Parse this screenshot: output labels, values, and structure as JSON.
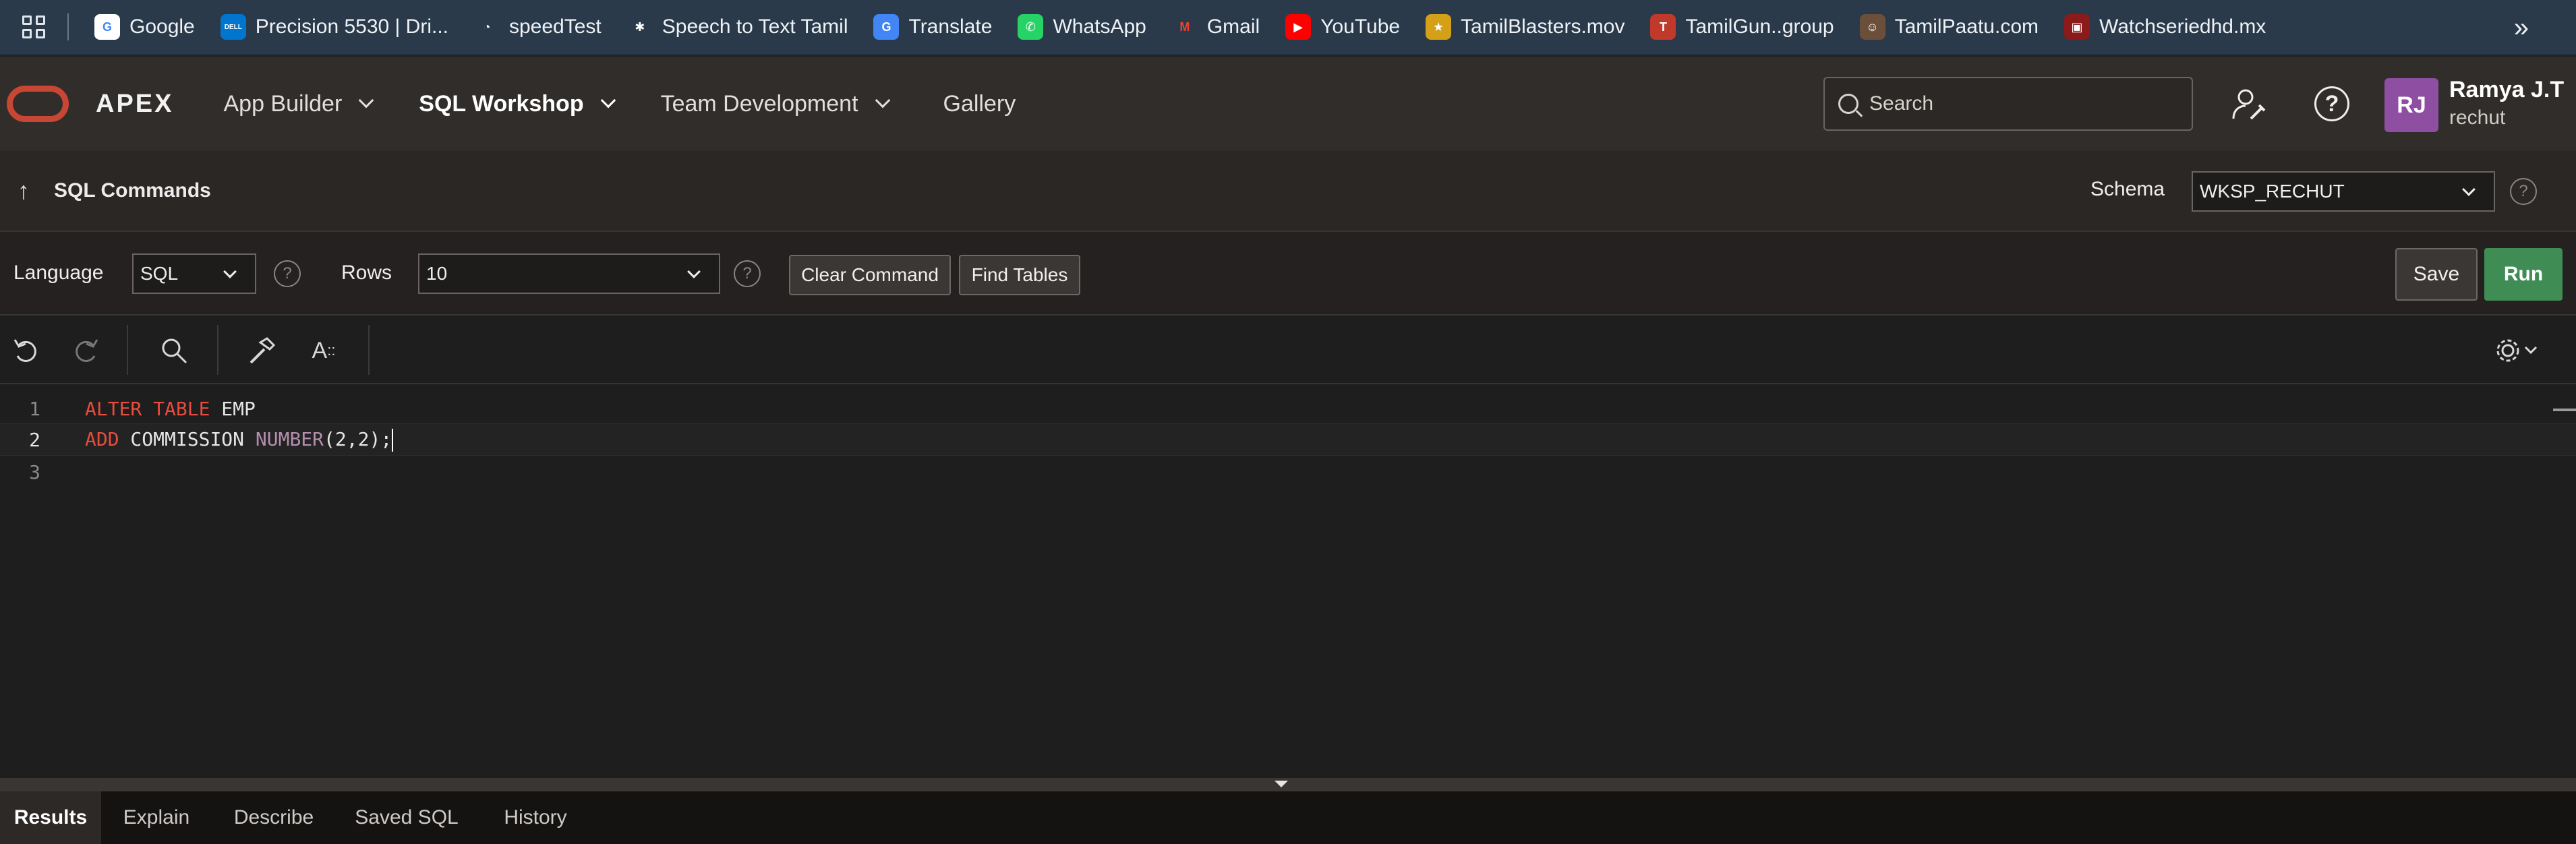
{
  "bookmarks": [
    {
      "label": "Google",
      "icon": "google-icon",
      "color": "#ffffff",
      "glyph": "G",
      "glyph_color": "#4285f4"
    },
    {
      "label": "Precision 5530 | Dri...",
      "icon": "dell-icon",
      "color": "#0076ce",
      "glyph": "DELL",
      "glyph_color": "#ffffff"
    },
    {
      "label": "speedTest",
      "icon": "speedtest-icon",
      "color": "#2a3a4a",
      "glyph": "◔",
      "glyph_color": "#ffffff"
    },
    {
      "label": "Speech to Text Tamil",
      "icon": "joomla-icon",
      "color": "#2a3a4a",
      "glyph": "✱",
      "glyph_color": "#ffffff"
    },
    {
      "label": "Translate",
      "icon": "translate-icon",
      "color": "#4285f4",
      "glyph": "G",
      "glyph_color": "#ffffff"
    },
    {
      "label": "WhatsApp",
      "icon": "whatsapp-icon",
      "color": "#25d366",
      "glyph": "✆",
      "glyph_color": "#ffffff"
    },
    {
      "label": "Gmail",
      "icon": "gmail-icon",
      "color": "#2a3a4a",
      "glyph": "M",
      "glyph_color": "#ea4335"
    },
    {
      "label": "YouTube",
      "icon": "youtube-icon",
      "color": "#ff0000",
      "glyph": "▶",
      "glyph_color": "#ffffff"
    },
    {
      "label": "TamilBlasters.mov",
      "icon": "tamilblasters-icon",
      "color": "#d4a017",
      "glyph": "★",
      "glyph_color": "#ffffff"
    },
    {
      "label": "TamilGun..group",
      "icon": "tamilgun-icon",
      "color": "#c0392b",
      "glyph": "T",
      "glyph_color": "#ffffff"
    },
    {
      "label": "TamilPaatu.com",
      "icon": "tamilpaatu-icon",
      "color": "#6b4f3a",
      "glyph": "☺",
      "glyph_color": "#ffffff"
    },
    {
      "label": "Watchseriedhd.mx",
      "icon": "watchseries-icon",
      "color": "#8b1a1a",
      "glyph": "▣",
      "glyph_color": "#ffffff"
    }
  ],
  "header": {
    "app_name": "APEX",
    "nav": [
      {
        "label": "App Builder",
        "has_menu": true,
        "active": false
      },
      {
        "label": "SQL Workshop",
        "has_menu": true,
        "active": true
      },
      {
        "label": "Team Development",
        "has_menu": true,
        "active": false
      },
      {
        "label": "Gallery",
        "has_menu": false,
        "active": false
      }
    ],
    "search_placeholder": "Search",
    "user": {
      "initials": "RJ",
      "name": "Ramya J.T",
      "workspace": "rechut"
    }
  },
  "sql_commands": {
    "title": "SQL Commands",
    "schema_label": "Schema",
    "schema_value": "WKSP_RECHUT",
    "language_label": "Language",
    "language_value": "SQL",
    "rows_label": "Rows",
    "rows_value": "10",
    "clear_label": "Clear Command",
    "find_label": "Find Tables",
    "save_label": "Save",
    "run_label": "Run"
  },
  "editor": {
    "line_numbers": [
      "1",
      "2",
      "3"
    ],
    "lines": [
      [
        {
          "t": "ALTER",
          "c": "kw"
        },
        {
          "t": " "
        },
        {
          "t": "TABLE",
          "c": "kw"
        },
        {
          "t": " EMP"
        }
      ],
      [
        {
          "t": "ADD",
          "c": "kw"
        },
        {
          "t": " COMMISSION "
        },
        {
          "t": "NUMBER",
          "c": "fn"
        },
        {
          "t": "(2,2);"
        }
      ],
      []
    ],
    "active_line": 2
  },
  "results_tabs": [
    "Results",
    "Explain",
    "Describe",
    "Saved SQL",
    "History"
  ],
  "colors": {
    "keyword": "#e84c3d",
    "function": "#b48ead",
    "run_button": "#3f8c54",
    "oracle_red": "#c74634",
    "avatar": "#8e4fa3"
  }
}
